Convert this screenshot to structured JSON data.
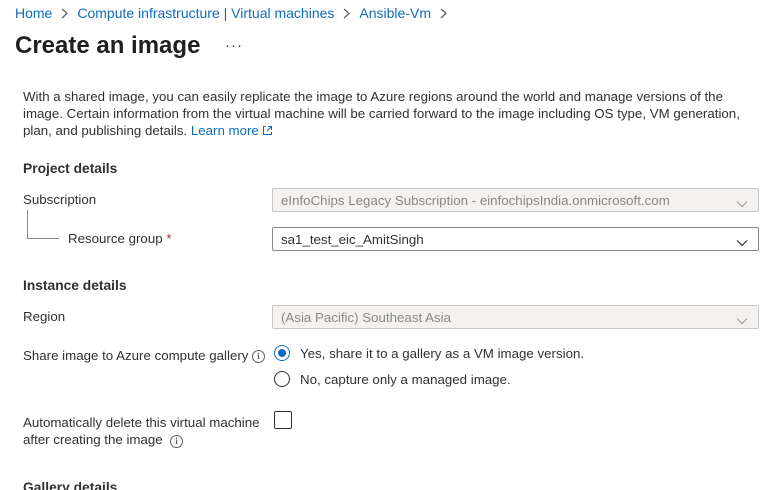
{
  "breadcrumb": {
    "items": [
      "Home",
      "Compute infrastructure | Virtual machines",
      "Ansible-Vm"
    ]
  },
  "page": {
    "title": "Create an image",
    "more_label": "···"
  },
  "intro": {
    "text": "With a shared image, you can easily replicate the image to Azure regions around the world and manage versions of the image. Certain information from the virtual machine will be carried forward to the image including OS type, VM generation, plan, and publishing details.",
    "learn_more": "Learn more"
  },
  "project_details": {
    "heading": "Project details",
    "subscription_label": "Subscription",
    "subscription_value": "eInfoChips Legacy Subscription - einfochipsIndia.onmicrosoft.com",
    "resource_group_label": "Resource group",
    "resource_group_required": "*",
    "resource_group_value": "sa1_test_eic_AmitSingh"
  },
  "instance_details": {
    "heading": "Instance details",
    "region_label": "Region",
    "region_value": "(Asia Pacific) Southeast Asia",
    "share_label": "Share image to Azure compute gallery",
    "share_options": [
      "Yes, share it to a gallery as a VM image version.",
      "No, capture only a managed image."
    ],
    "share_selected": "Yes, share it to a gallery as a VM image version.",
    "auto_delete_label_line1": "Automatically delete this virtual machine",
    "auto_delete_label_line2": "after creating the image",
    "auto_delete_checked": false
  },
  "gallery_details": {
    "heading": "Gallery details"
  },
  "colors": {
    "accent": "#0f6cbd",
    "text": "#323130",
    "required": "#a4262c",
    "disabled_bg": "#f3f2f1"
  },
  "icons": [
    "chevron-right-icon",
    "external-link-icon",
    "chevron-down-icon",
    "info-icon"
  ]
}
